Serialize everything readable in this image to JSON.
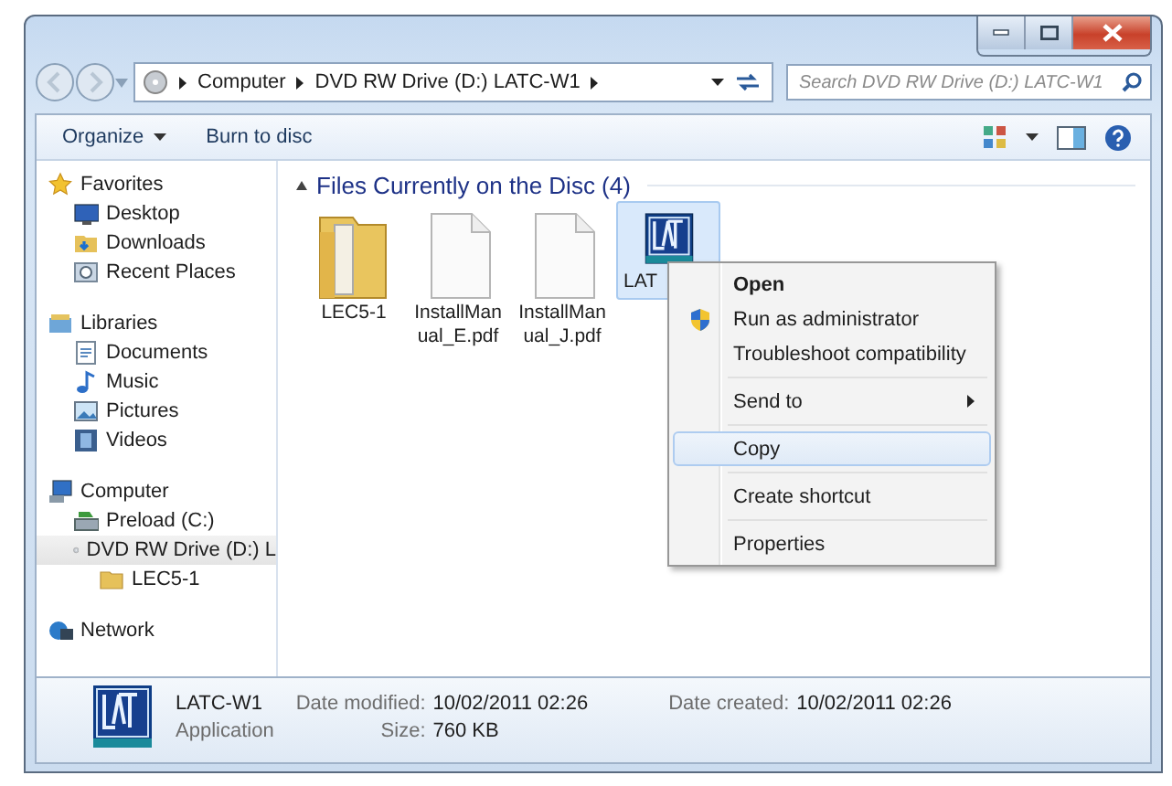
{
  "address_bar": {
    "crumbs": [
      "Computer",
      "DVD RW Drive (D:) LATC-W1"
    ]
  },
  "search": {
    "placeholder": "Search DVD RW Drive (D:) LATC-W1"
  },
  "toolbar": {
    "buttons": [
      {
        "label": "Organize",
        "has_menu": true
      },
      {
        "label": "Burn to disc",
        "has_menu": false
      }
    ]
  },
  "sidebar": {
    "groups": [
      {
        "label": "Favorites",
        "selected": false,
        "children": [
          {
            "label": "Desktop",
            "selected": false
          },
          {
            "label": "Downloads",
            "selected": false
          },
          {
            "label": "Recent Places",
            "selected": false
          }
        ]
      },
      {
        "label": "Libraries",
        "selected": false,
        "children": [
          {
            "label": "Documents",
            "selected": false
          },
          {
            "label": "Music",
            "selected": false
          },
          {
            "label": "Pictures",
            "selected": false
          },
          {
            "label": "Videos",
            "selected": false
          }
        ]
      },
      {
        "label": "Computer",
        "selected": false,
        "children": [
          {
            "label": "Preload (C:)",
            "selected": false
          },
          {
            "label": "DVD RW Drive (D:) L",
            "selected": true,
            "children": [
              {
                "label": "LEC5-1",
                "selected": false
              }
            ]
          }
        ]
      },
      {
        "label": "Network",
        "selected": false
      }
    ]
  },
  "content": {
    "group_header": "Files Currently on the Disc (4)",
    "files": [
      {
        "name": "LEC5-1",
        "kind": "folder",
        "selected": false
      },
      {
        "name": "InstallManual_E.pdf",
        "kind": "document",
        "selected": false
      },
      {
        "name": "InstallManual_J.pdf",
        "kind": "document",
        "selected": false
      },
      {
        "name": "LAT",
        "kind": "app",
        "selected": true
      }
    ]
  },
  "context_menu": {
    "items": [
      {
        "kind": "item",
        "label": "Open",
        "default": true,
        "shield": false,
        "submenu": false,
        "selected": false
      },
      {
        "kind": "item",
        "label": "Run as administrator",
        "default": false,
        "shield": true,
        "submenu": false,
        "selected": false
      },
      {
        "kind": "item",
        "label": "Troubleshoot compatibility",
        "default": false,
        "shield": false,
        "submenu": false,
        "selected": false
      },
      {
        "kind": "separator"
      },
      {
        "kind": "item",
        "label": "Send to",
        "default": false,
        "shield": false,
        "submenu": true,
        "selected": false
      },
      {
        "kind": "separator"
      },
      {
        "kind": "item",
        "label": "Copy",
        "default": false,
        "shield": false,
        "submenu": false,
        "selected": true
      },
      {
        "kind": "separator"
      },
      {
        "kind": "item",
        "label": "Create shortcut",
        "default": false,
        "shield": false,
        "submenu": false,
        "selected": false
      },
      {
        "kind": "separator"
      },
      {
        "kind": "item",
        "label": "Properties",
        "default": false,
        "shield": false,
        "submenu": false,
        "selected": false
      }
    ]
  },
  "details": {
    "name": "LATC-W1",
    "type": "Application",
    "fields": [
      {
        "label": "Date modified:",
        "value": "10/02/2011 02:26"
      },
      {
        "label": "Date created:",
        "value": "10/02/2011 02:26"
      },
      {
        "label": "Size:",
        "value": "760 KB"
      }
    ]
  }
}
